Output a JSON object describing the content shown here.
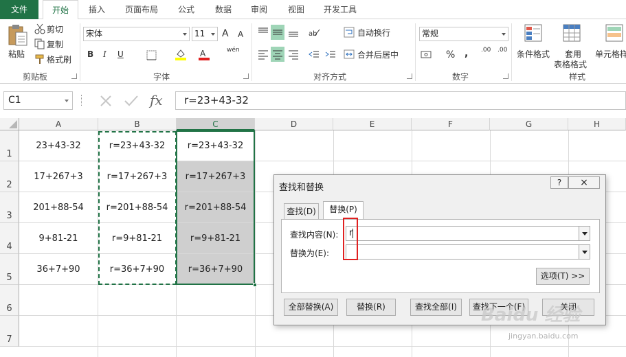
{
  "ribbon_tabs": [
    "文件",
    "开始",
    "插入",
    "页面布局",
    "公式",
    "数据",
    "审阅",
    "视图",
    "开发工具"
  ],
  "clipboard": {
    "paste": "粘贴",
    "cut": "剪切",
    "copy": "复制",
    "format_painter": "格式刷",
    "label": "剪贴板"
  },
  "font": {
    "name": "宋体",
    "size": "11",
    "bold": "B",
    "italic": "I",
    "underline": "U",
    "grow": "A",
    "shrink": "A",
    "phonetic": "wén",
    "label": "字体"
  },
  "alignment": {
    "wrap": "自动换行",
    "merge": "合并后居中",
    "label": "对齐方式"
  },
  "number": {
    "format": "常规",
    "label": "数字",
    "percent": "%",
    "comma": ",",
    "inc_decimal": ".00",
    "dec_decimal": ".00"
  },
  "styles": {
    "conditional": "条件格式",
    "table_l1": "套用",
    "table_l2": "表格格式",
    "cell": "单元格样",
    "label": "样式"
  },
  "formula_bar": {
    "name_box": "C1",
    "fx": "fx",
    "formula": "r=23+43-32"
  },
  "columns": [
    "A",
    "B",
    "C",
    "D",
    "E",
    "F",
    "G",
    "H"
  ],
  "rows": [
    "1",
    "2",
    "3",
    "4",
    "5",
    "6",
    "7"
  ],
  "cells": [
    [
      "23+43-32",
      "r=23+43-32",
      "r=23+43-32"
    ],
    [
      "17+267+3",
      "r=17+267+3",
      "r=17+267+3"
    ],
    [
      "201+88-54",
      "r=201+88-54",
      "r=201+88-54"
    ],
    [
      "9+81-21",
      "r=9+81-21",
      "r=9+81-21"
    ],
    [
      "36+7+90",
      "r=36+7+90",
      "r=36+7+90"
    ]
  ],
  "dialog": {
    "title": "查找和替换",
    "help": "?",
    "close": "×",
    "tab_find": "查找(D)",
    "tab_replace": "替换(P)",
    "find_label": "查找内容(N):",
    "find_value": "r",
    "replace_label": "替换为(E):",
    "replace_value": "",
    "options": "选项(T) >>",
    "replace_all": "全部替换(A)",
    "replace": "替换(R)",
    "find_all": "查找全部(I)",
    "find_next": "查找下一个(F)",
    "close_btn": "关闭"
  },
  "watermark": {
    "brand": "Baidu 经验",
    "url": "jingyan.baidu.com"
  }
}
